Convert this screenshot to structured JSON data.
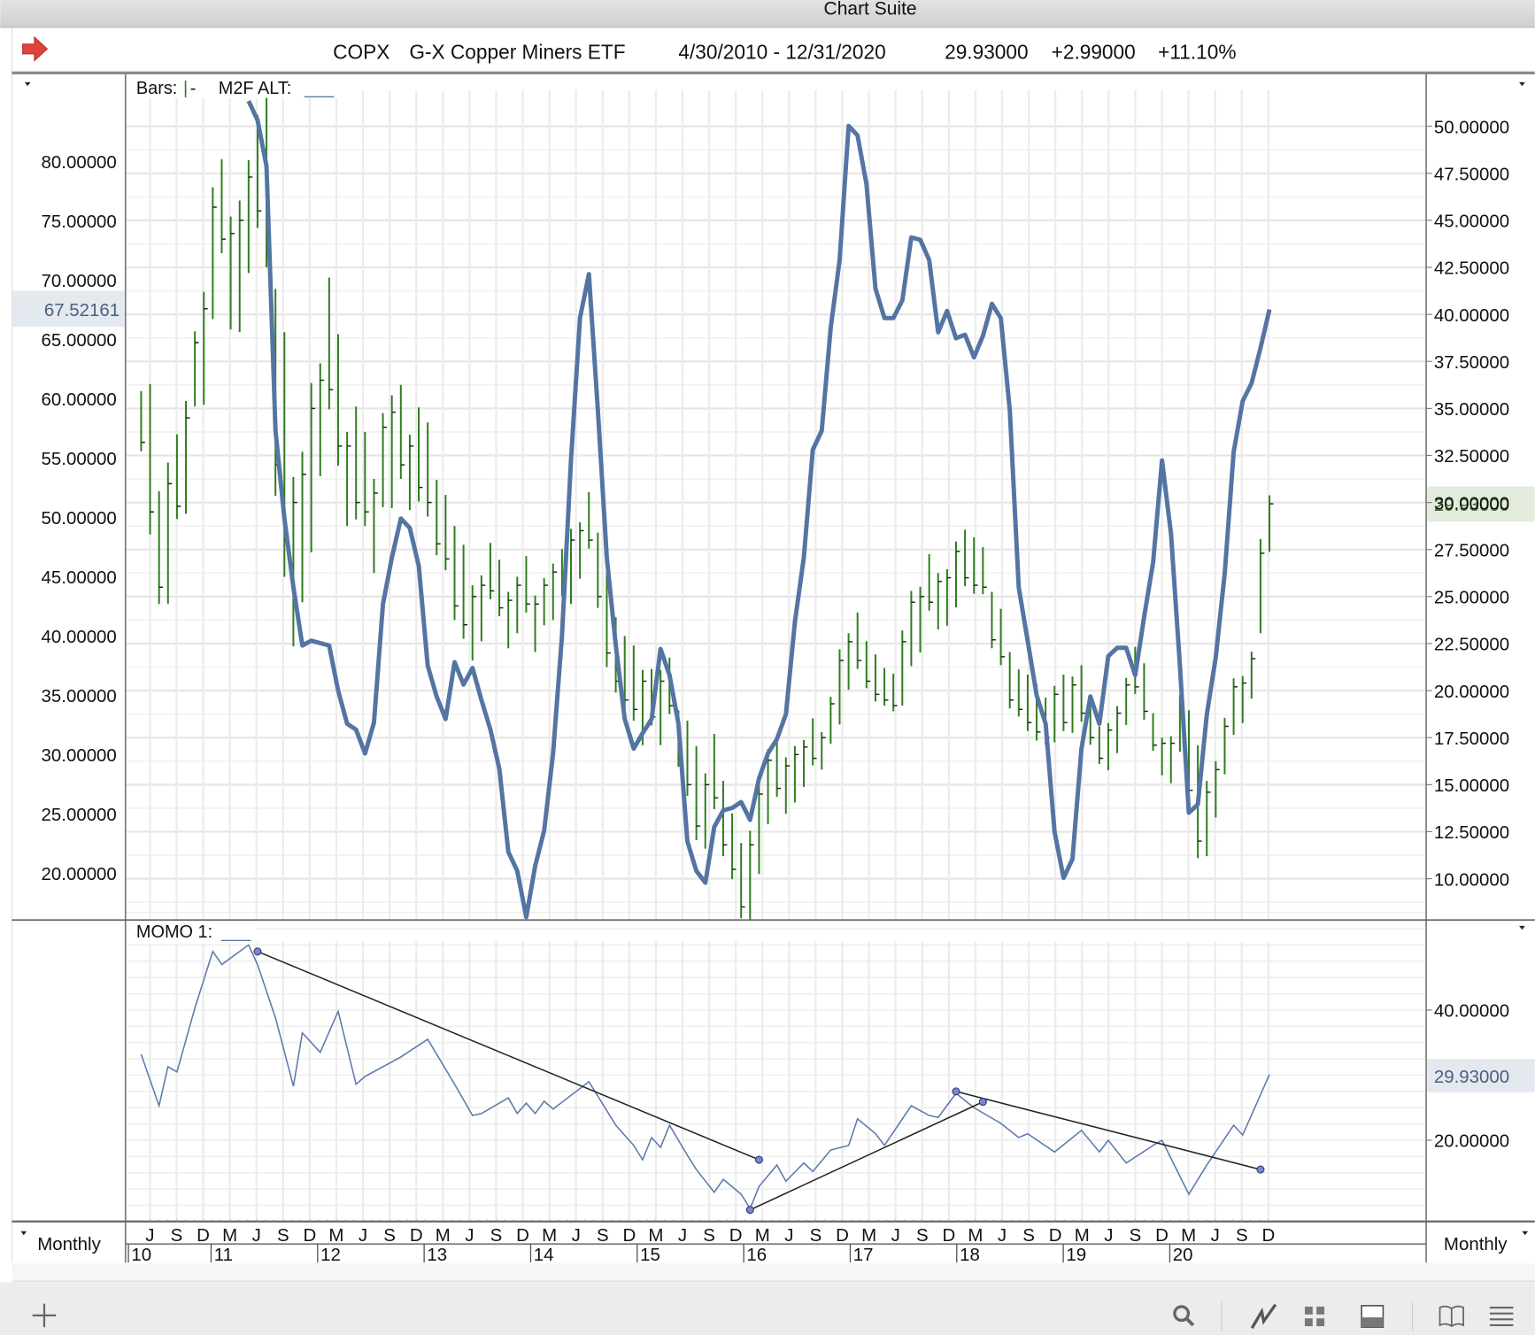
{
  "window": {
    "title": "Chart Suite"
  },
  "header": {
    "symbol": "COPX",
    "name": "G-X Copper Miners ETF",
    "date_range": "4/30/2010 - 12/31/2020",
    "last": "29.93000",
    "change": "+2.99000",
    "change_pct": "+11.10%"
  },
  "price_panel": {
    "bars_label": "Bars:",
    "bars_symbol_bar": "|",
    "bars_symbol_tick": "-",
    "indicator_label": "M2F ALT:",
    "indicator_blank": "___",
    "left_current": "67.52161",
    "right_current": "29.93000"
  },
  "momo_panel": {
    "label": "MOMO 1:",
    "blank": "___",
    "right_current": "29.93000"
  },
  "time_axis": {
    "left_period": "Monthly",
    "right_period": "Monthly"
  },
  "toolbar": {
    "left_icons": [
      "plus-icon"
    ],
    "right_icons": [
      "search-icon",
      "line-chart-icon",
      "grid-icon",
      "panel-icon",
      "book-icon",
      "list-icon"
    ]
  },
  "colors": {
    "bars": "#2f7d1f",
    "m2f_line": "#5475a3",
    "momo_line": "#5a7aab",
    "trendline": "#222222",
    "trend_point": "#7d84d8",
    "right_current_bg": "#e3ecdc",
    "left_current_bg": "#e4e8ef",
    "arrow": "#e0433a"
  },
  "chart_data": [
    {
      "type": "bar",
      "title": "COPX G-X Copper Miners ETF",
      "x_start": "2010-06",
      "x_unit": "month",
      "month_labels": [
        "J",
        "S",
        "D",
        "M",
        "J",
        "S",
        "D",
        "M",
        "J",
        "S",
        "D",
        "M",
        "J",
        "S",
        "D",
        "M",
        "J",
        "S",
        "D",
        "M",
        "J",
        "S",
        "D",
        "M",
        "J",
        "S",
        "D",
        "M",
        "J",
        "S",
        "D",
        "M",
        "J",
        "S",
        "D",
        "M",
        "J",
        "S",
        "D",
        "M",
        "J",
        "S",
        "D"
      ],
      "year_labels": [
        "10",
        "11",
        "12",
        "13",
        "14",
        "15",
        "16",
        "17",
        "18",
        "19",
        "20"
      ],
      "right_axis": {
        "ylim": [
          8,
          51
        ],
        "ticks": [
          "50.00000",
          "47.50000",
          "45.00000",
          "42.50000",
          "40.00000",
          "37.50000",
          "35.00000",
          "32.50000",
          "30.00000",
          "27.50000",
          "25.00000",
          "22.50000",
          "20.00000",
          "17.50000",
          "15.00000",
          "12.50000",
          "10.00000"
        ]
      },
      "left_axis": {
        "ylim": [
          17,
          86
        ],
        "ticks": [
          "80.00000",
          "75.00000",
          "70.00000",
          "65.00000",
          "60.00000",
          "55.00000",
          "50.00000",
          "45.00000",
          "40.00000",
          "35.00000",
          "30.00000",
          "25.00000",
          "20.00000"
        ]
      },
      "bars": {
        "name": "COPX monthly bars (right axis)",
        "close": [
          33.2,
          29.5,
          25.5,
          31,
          29.8,
          34.5,
          38.5,
          40.3,
          45.7,
          44,
          44.3,
          45,
          47.3,
          45.5,
          44,
          32,
          28,
          30,
          31.5,
          35,
          36.5,
          36,
          33,
          33,
          30,
          29.5,
          30.5,
          34,
          34.8,
          32,
          33,
          30.8,
          30,
          27.8,
          27,
          24.5,
          23.5,
          25,
          25.6,
          25.3,
          24.4,
          24.8,
          25.6,
          24.6,
          24.6,
          25.6,
          26.3,
          25.4,
          28,
          28.5,
          28,
          25,
          22,
          20.5,
          19.5,
          19,
          20.5,
          18.6,
          20.5,
          19.2,
          16.4,
          15,
          12.8,
          15,
          14.3,
          11.8,
          10.5,
          8.5,
          11.8,
          14.5,
          16.3,
          14.8,
          16,
          16.6,
          17,
          16.4,
          17.5,
          19.3,
          21.6,
          22.6,
          21.6,
          20.5,
          19.8,
          19.5,
          19.2,
          22.6,
          24.7,
          25,
          24.7,
          25.8,
          26,
          27.4,
          26,
          25.6,
          25.5,
          22.7,
          21.8,
          19.5,
          19,
          18.3,
          17.8,
          17.5,
          19.8,
          18.3,
          20.3,
          18.8,
          17.5,
          16.4,
          17.9,
          18.8,
          20.3,
          20.2,
          18.9,
          17.1,
          17.2,
          17.2,
          19.3,
          14.7,
          12,
          14.6,
          15.8,
          18.1,
          20.2,
          20.4,
          21.7,
          27.3,
          29.93
        ],
        "span": [
          3.2,
          8,
          6,
          7.5,
          4.5,
          6,
          4,
          6,
          7,
          5,
          6,
          7,
          6,
          6,
          10,
          11,
          13,
          9,
          8,
          9,
          6,
          7,
          7,
          5,
          6,
          5,
          5,
          5,
          6,
          5,
          4,
          5,
          5,
          4,
          4,
          5,
          5,
          4,
          3.5,
          3,
          3,
          3,
          3,
          3,
          3,
          2.5,
          3,
          2.5,
          4,
          3,
          3,
          4,
          5,
          4,
          4,
          4,
          4,
          3,
          4,
          3,
          3,
          4,
          5,
          4,
          4,
          4,
          3.5,
          4,
          5,
          5,
          4,
          3,
          3,
          3,
          2.5,
          2.5,
          2,
          2.5,
          4,
          3,
          3,
          2.5,
          2.5,
          2,
          2,
          4,
          4,
          3.5,
          3,
          3,
          3,
          3.5,
          3,
          3,
          2.5,
          3,
          3,
          3,
          2.5,
          3,
          3,
          2.5,
          3,
          3,
          3,
          3,
          2.5,
          2,
          2.5,
          2.5,
          2.5,
          2.5,
          3,
          2,
          2,
          2.5,
          3,
          5,
          6,
          4,
          3,
          3,
          3,
          2.5,
          2.5,
          5,
          3
        ]
      },
      "m2f_alt": {
        "name": "M2F ALT (left axis)",
        "start_index": 12,
        "values": [
          85.1,
          83.5,
          79.6,
          57.3,
          49.9,
          44.1,
          39.2,
          39.6,
          39.4,
          39.2,
          35.4,
          32.6,
          32.1,
          30.1,
          32.7,
          42.7,
          46.6,
          49.9,
          49.1,
          45.9,
          37.5,
          34.9,
          33,
          37.8,
          35.9,
          37.3,
          34.6,
          32.1,
          28.8,
          21.8,
          20.2,
          16.3,
          20.6,
          23.6,
          30.1,
          40,
          54.8,
          66.8,
          70.5,
          59,
          46.6,
          39.2,
          33,
          30.5,
          31.8,
          33,
          38.9,
          36.7,
          32.6,
          22.7,
          20.2,
          19.2,
          23.9,
          25.3,
          25.5,
          26,
          24.5,
          28,
          30.1,
          31.3,
          33.4,
          41.2,
          46.6,
          55.7,
          57.3,
          66,
          71.7,
          83,
          82.2,
          78.1,
          69.3,
          66.8,
          66.8,
          68.3,
          73.6,
          73.4,
          71.7,
          65.6,
          67.4,
          65.1,
          65.4,
          63.5,
          65.3,
          68,
          66.8,
          59,
          44.1,
          39.6,
          35,
          32.6,
          23.5,
          19.6,
          21.2,
          30.5,
          34.9,
          32.6,
          38.3,
          39,
          39,
          36.7,
          41.6,
          46.2,
          54.8,
          48.6,
          37.5,
          25.1,
          25.8,
          33.4,
          38.2,
          45.3,
          55.5,
          59.8,
          61.3,
          64.3,
          67.52161
        ]
      }
    },
    {
      "type": "line",
      "title": "MOMO 1",
      "x_unit": "months since 2010-06",
      "ylim": [
        5,
        55
      ],
      "ticks": [
        "40.00000",
        "20.00000"
      ],
      "series": [
        {
          "name": "MOMO 1",
          "points": [
            [
              0,
              33.2
            ],
            [
              2,
              25.3
            ],
            [
              3,
              31.3
            ],
            [
              4,
              30.5
            ],
            [
              6,
              40.3
            ],
            [
              8,
              49
            ],
            [
              9,
              47
            ],
            [
              10,
              48
            ],
            [
              12,
              50
            ],
            [
              13,
              47
            ],
            [
              15,
              38.8
            ],
            [
              17,
              28.3
            ],
            [
              18,
              36.5
            ],
            [
              20,
              33.5
            ],
            [
              22,
              39.8
            ],
            [
              24,
              28.6
            ],
            [
              25,
              29.8
            ],
            [
              29,
              32.8
            ],
            [
              32,
              35.5
            ],
            [
              35,
              28.6
            ],
            [
              37,
              23.8
            ],
            [
              38,
              24.1
            ],
            [
              41,
              26.5
            ],
            [
              42,
              24.1
            ],
            [
              43,
              25.7
            ],
            [
              44,
              24.1
            ],
            [
              45,
              26
            ],
            [
              46,
              24.8
            ],
            [
              50,
              29
            ],
            [
              53,
              22.3
            ],
            [
              55,
              19.2
            ],
            [
              56,
              17
            ],
            [
              57,
              20.4
            ],
            [
              58,
              18.9
            ],
            [
              59,
              22.3
            ],
            [
              61,
              17.7
            ],
            [
              62,
              15.5
            ],
            [
              64,
              12
            ],
            [
              65,
              14
            ],
            [
              67,
              11.7
            ],
            [
              68,
              9.5
            ],
            [
              69,
              12.9
            ],
            [
              71,
              16.2
            ],
            [
              72,
              13.7
            ],
            [
              74,
              16.5
            ],
            [
              75,
              15.2
            ],
            [
              77,
              18.5
            ],
            [
              79,
              19.2
            ],
            [
              80,
              23.3
            ],
            [
              82,
              21
            ],
            [
              83,
              19.2
            ],
            [
              86,
              25.3
            ],
            [
              88,
              23.8
            ],
            [
              89,
              23.5
            ],
            [
              91,
              27.2
            ],
            [
              93,
              25
            ],
            [
              96,
              22.6
            ],
            [
              98,
              20.4
            ],
            [
              99,
              21
            ],
            [
              102,
              18.2
            ],
            [
              105,
              21.5
            ],
            [
              107,
              18.2
            ],
            [
              108,
              20
            ],
            [
              110,
              16.5
            ],
            [
              113,
              19.2
            ],
            [
              114,
              20
            ],
            [
              117,
              11.7
            ],
            [
              119,
              16.2
            ],
            [
              122,
              22.3
            ],
            [
              123,
              20.8
            ],
            [
              126,
              30.1
            ]
          ]
        }
      ],
      "trendlines": [
        {
          "from": [
            13,
            49
          ],
          "to": [
            69,
            17
          ]
        },
        {
          "from": [
            68,
            9.3
          ],
          "to": [
            94,
            25.9
          ]
        },
        {
          "from": [
            91,
            27.5
          ],
          "to": [
            125,
            15.5
          ]
        }
      ]
    }
  ]
}
